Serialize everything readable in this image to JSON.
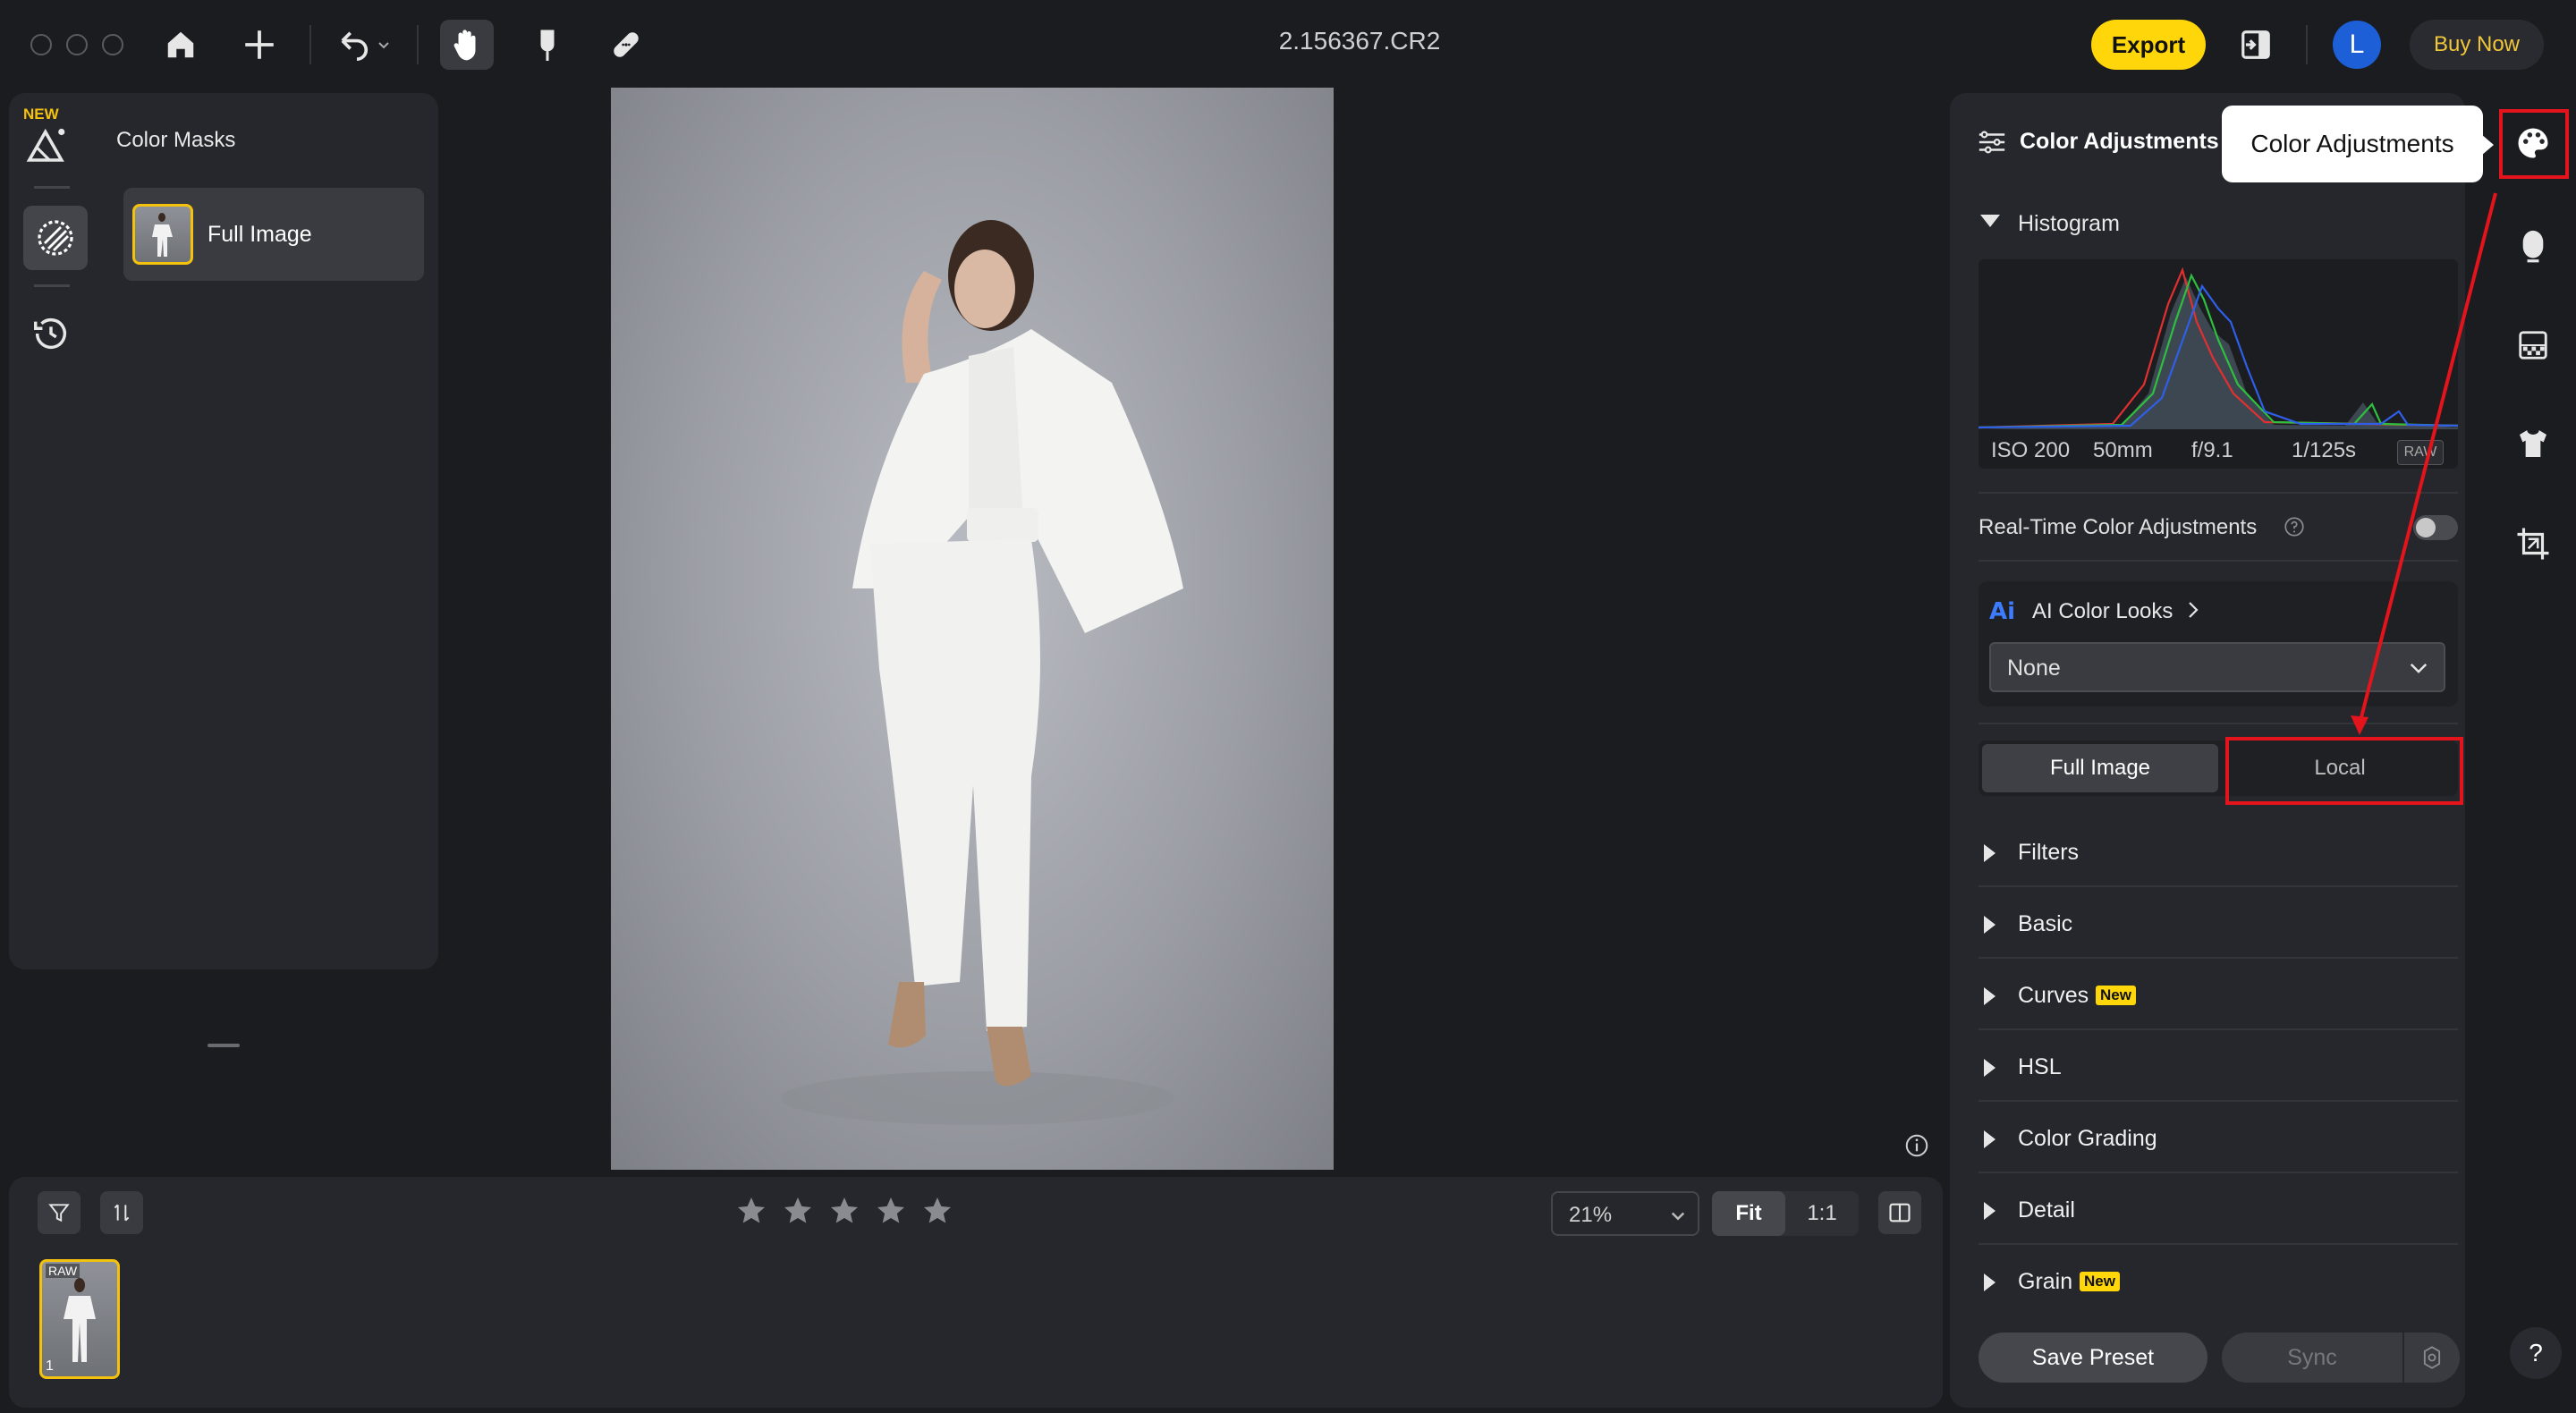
{
  "window": {
    "title": "2.156367.CR2"
  },
  "toolbar": {
    "home_icon": "home-icon",
    "add_icon": "plus-icon",
    "undo_icon": "undo-icon",
    "hand_icon": "hand-icon",
    "retouch_icon": "finger-retouch-icon",
    "heal_icon": "bandage-icon",
    "export_label": "Export",
    "avatar_letter": "L",
    "buy_label": "Buy Now"
  },
  "left_panel": {
    "new_badge": "NEW",
    "title": "Color Masks",
    "masks": [
      {
        "label": "Full Image"
      }
    ]
  },
  "bottom_bar": {
    "rating_stars": 5,
    "zoom": "21%",
    "fit_label": "Fit",
    "one_to_one_label": "1:1",
    "thumbnail": {
      "badge": "RAW",
      "index": "1"
    }
  },
  "right_panel": {
    "title": "Color Adjustments",
    "tooltip": "Color Adjustments",
    "histogram_label": "Histogram",
    "exif": {
      "iso": "ISO 200",
      "focal": "50mm",
      "aperture": "f/9.1",
      "shutter": "1/125s",
      "format": "RAW"
    },
    "realtime_label": "Real-Time Color Adjustments",
    "realtime_enabled": false,
    "ai_looks_label": "AI Color Looks",
    "ai_looks_value": "None",
    "scope_full": "Full Image",
    "scope_local": "Local",
    "sections": [
      {
        "label": "Filters",
        "badge": ""
      },
      {
        "label": "Basic",
        "badge": ""
      },
      {
        "label": "Curves",
        "badge": "New"
      },
      {
        "label": "HSL",
        "badge": ""
      },
      {
        "label": "Color Grading",
        "badge": ""
      },
      {
        "label": "Detail",
        "badge": ""
      },
      {
        "label": "Grain",
        "badge": "New"
      }
    ],
    "save_preset_label": "Save Preset",
    "sync_label": "Sync"
  },
  "rail": {
    "help_label": "?"
  },
  "colors": {
    "accent": "#ffd60a",
    "highlight": "#e3141b",
    "avatar": "#1c5fd6"
  }
}
